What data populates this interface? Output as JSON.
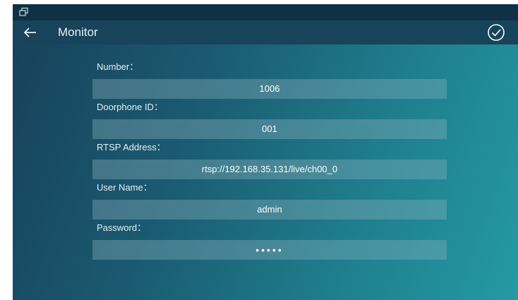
{
  "status_bar": {
    "icon": "window-restore-icon"
  },
  "header": {
    "back_icon": "arrow-left-icon",
    "title": "Monitor",
    "confirm_icon": "check-circle-icon"
  },
  "form": {
    "fields": [
      {
        "label": "Number：",
        "value": "1006"
      },
      {
        "label": "Doorphone ID：",
        "value": "001"
      },
      {
        "label": "RTSP Address：",
        "value": "rtsp://192.168.35.131/live/ch00_0"
      },
      {
        "label": "User Name：",
        "value": "admin"
      },
      {
        "label": "Password：",
        "value": "•••••"
      }
    ]
  },
  "colors": {
    "status_bar": "#0e3146",
    "title_bar": "#17445b",
    "background_start": "#17405a",
    "background_end": "#249aa4"
  }
}
